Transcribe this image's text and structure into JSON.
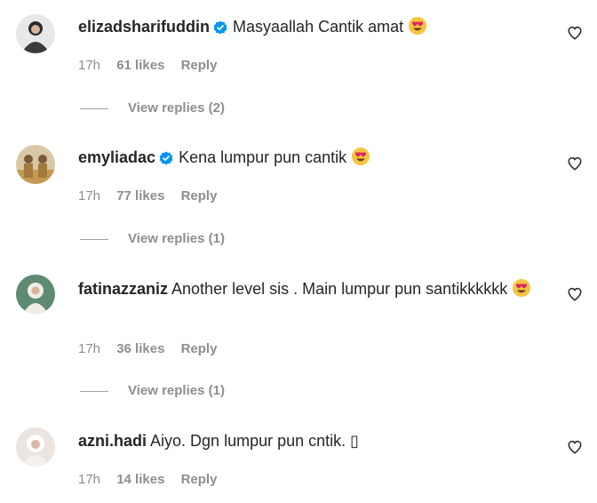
{
  "comments": [
    {
      "username": "elizadsharifuddin",
      "verified": true,
      "text": "Masyaallah Cantik amat",
      "emoji": "heart-eyes",
      "time": "17h",
      "likes": "61 likes",
      "reply": "Reply",
      "view_replies": "View replies (2)",
      "avatar_color": "#3b3b3b"
    },
    {
      "username": "emyliadac",
      "verified": true,
      "text": "Kena lumpur pun cantik",
      "emoji": "heart-eyes",
      "time": "17h",
      "likes": "77 likes",
      "reply": "Reply",
      "view_replies": "View replies (1)",
      "avatar_color": "#b8954f"
    },
    {
      "username": "fatinazzaniz",
      "verified": false,
      "text": "Another level sis . Main lumpur pun santikkkkkk",
      "emoji": "heart-eyes",
      "time": "17h",
      "likes": "36 likes",
      "reply": "Reply",
      "view_replies": "View replies (1)",
      "avatar_color": "#6f9a83"
    },
    {
      "username": "azni.hadi",
      "verified": false,
      "text": "Aiyo. Dgn lumpur pun cntik. ▯",
      "emoji": "",
      "time": "17h",
      "likes": "14 likes",
      "reply": "Reply",
      "view_replies": "",
      "avatar_color": "#d8c8c2"
    }
  ],
  "colors": {
    "text": "#262626",
    "muted": "#8e8e8e",
    "verified": "#0095f6"
  }
}
